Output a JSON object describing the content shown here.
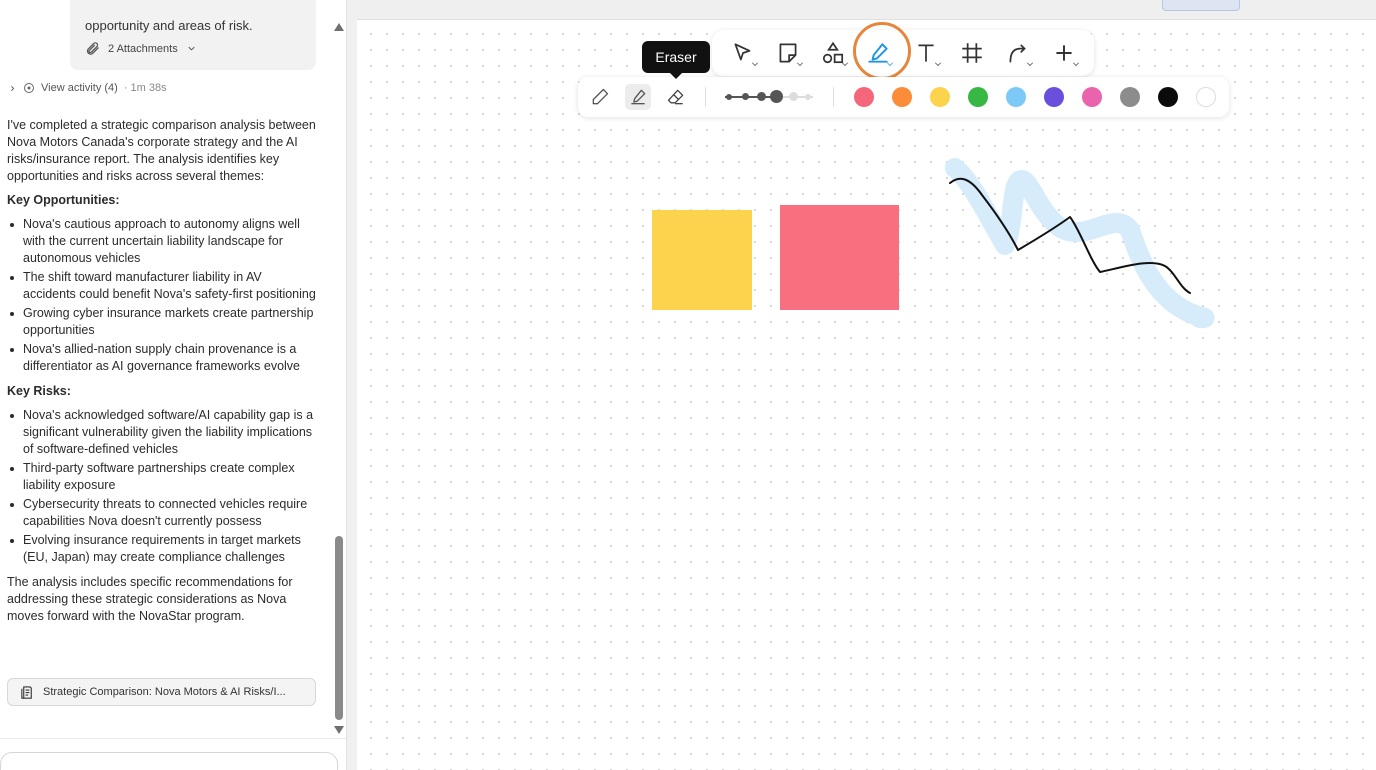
{
  "chat": {
    "previous_card": {
      "text": "opportunity and areas of risk.",
      "attachments_label": "2 Attachments"
    },
    "activity": {
      "label": "View activity (4)",
      "duration": "· 1m 38s"
    },
    "message": {
      "intro": "I've completed a strategic comparison analysis between Nova Motors Canada's corporate strategy and the AI risks/insurance report. The analysis identifies key opportunities and risks across several themes:",
      "opportunities_heading": "Key Opportunities:",
      "opportunities": [
        "Nova's cautious approach to autonomy aligns well with the current uncertain liability landscape for autonomous vehicles",
        "The shift toward manufacturer liability in AV accidents could benefit Nova's safety-first positioning",
        "Growing cyber insurance markets create partnership opportunities",
        "Nova's allied-nation supply chain provenance is a differentiator as AI governance frameworks evolve"
      ],
      "risks_heading": "Key Risks:",
      "risks": [
        "Nova's acknowledged software/AI capability gap is a significant vulnerability given the liability implications of software-defined vehicles",
        "Third-party software partnerships create complex liability exposure",
        "Cybersecurity threats to connected vehicles require capabilities Nova doesn't currently possess",
        "Evolving insurance requirements in target markets (EU, Japan) may create compliance challenges"
      ],
      "conclusion": "The analysis includes specific recommendations for addressing these strategic considerations as Nova moves forward with the NovaStar program."
    },
    "artifact_label": "Strategic Comparison: Nova Motors & AI Risks/I..."
  },
  "toolbar": {
    "tools": [
      "select-tool",
      "note-tool",
      "shapes-tool",
      "pen-tool",
      "text-tool",
      "frame-tool",
      "connector-tool",
      "add-tool"
    ],
    "active_tool": "pen-tool",
    "tooltip": "Eraser",
    "pen_modes": [
      "pencil",
      "highlighter",
      "eraser"
    ],
    "active_pen_mode": "highlighter",
    "selected_size_index": 3,
    "colors": [
      {
        "name": "red",
        "hex": "#f4677a"
      },
      {
        "name": "orange",
        "hex": "#fb8c3a"
      },
      {
        "name": "yellow",
        "hex": "#fbd34d"
      },
      {
        "name": "green",
        "hex": "#37b845"
      },
      {
        "name": "light-blue",
        "hex": "#7cc9f7"
      },
      {
        "name": "purple",
        "hex": "#6a4fdc"
      },
      {
        "name": "pink",
        "hex": "#e963ad"
      },
      {
        "name": "gray",
        "hex": "#8c8c8c"
      },
      {
        "name": "black",
        "hex": "#0b0b0b"
      },
      {
        "name": "white",
        "hex": "#ffffff"
      }
    ]
  },
  "canvas": {
    "stickies": [
      {
        "name": "yellow-sticky",
        "color": "#fbd34d"
      },
      {
        "name": "red-sticky",
        "color": "#f87080"
      }
    ],
    "highlighter_color": "#d6ecfb",
    "pen_color": "#111111"
  }
}
